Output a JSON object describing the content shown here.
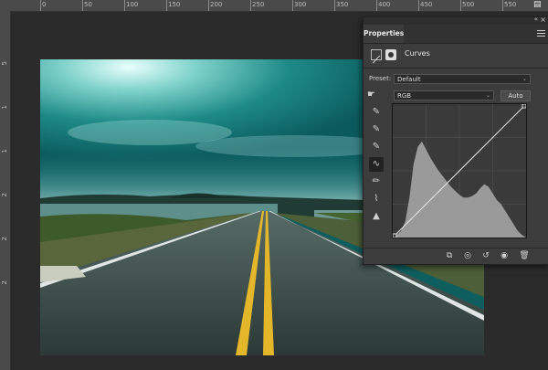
{
  "ruler": {
    "top_labels": [
      "0",
      "50",
      "100",
      "150",
      "200",
      "250",
      "300",
      "350",
      "400",
      "450",
      "500",
      "550"
    ],
    "left_labels": [
      "5",
      "1",
      "1",
      "2",
      "2",
      "2"
    ]
  },
  "properties": {
    "tab_label": "Properties",
    "adjustment_title": "Curves",
    "preset_label": "Preset:",
    "preset_value": "Default",
    "channel_value": "RGB",
    "auto_label": "Auto"
  },
  "icons": {
    "panel_collapse": "double-chevron-icon",
    "panel_close": "close-icon",
    "panel_menu": "hamburger-menu-icon",
    "curves_layer": "curves-adjustment-icon",
    "mask": "layer-mask-icon",
    "target_adjust": "hand-target-icon",
    "tools": [
      "eyedropper-black-icon",
      "eyedropper-gray-icon",
      "eyedropper-white-icon",
      "curve-point-icon",
      "pencil-icon",
      "smooth-icon",
      "clipping-warning-icon"
    ],
    "bottom": [
      "clip-to-layer-icon",
      "view-previous-icon",
      "reset-icon",
      "visibility-eye-icon",
      "trash-icon"
    ]
  },
  "colors": {
    "panel_bg": "#3c3c3c",
    "histogram": "#9a9a9a",
    "sky_teal": "#0f6f6f"
  },
  "histogram_levels": [
    0.0,
    0.02,
    0.05,
    0.12,
    0.3,
    0.55,
    0.68,
    0.72,
    0.66,
    0.6,
    0.55,
    0.5,
    0.46,
    0.42,
    0.38,
    0.35,
    0.32,
    0.3,
    0.3,
    0.31,
    0.33,
    0.37,
    0.4,
    0.38,
    0.33,
    0.28,
    0.25,
    0.2,
    0.15,
    0.1,
    0.05,
    0.02,
    0.0
  ]
}
